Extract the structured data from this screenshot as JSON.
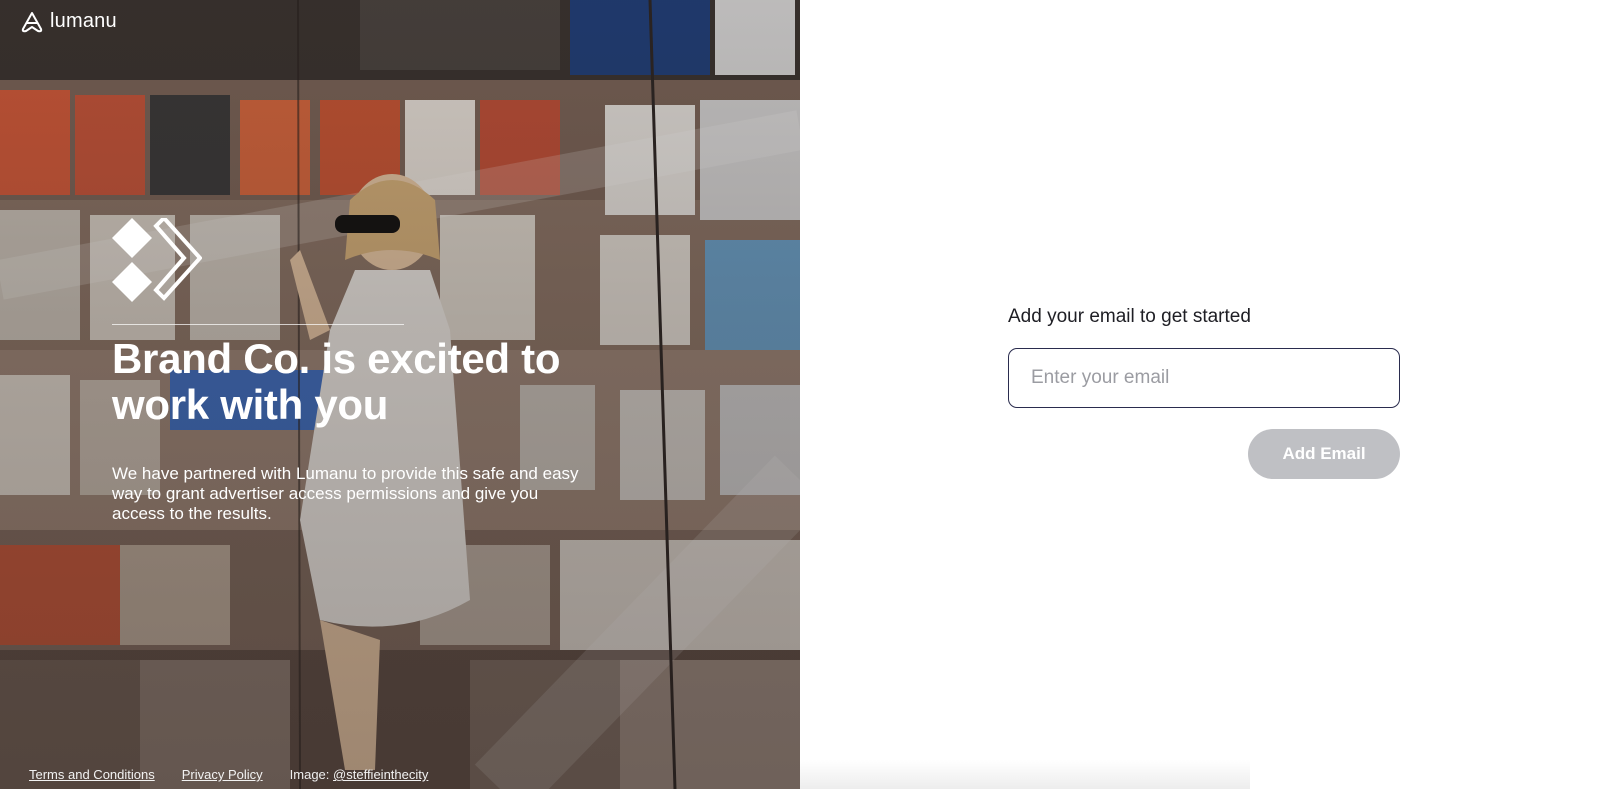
{
  "brand": {
    "name": "lumanu",
    "icon": "lumanu-logo-icon"
  },
  "hero": {
    "partner_logo": "partner-x-logo",
    "title": "Brand Co. is excited to work with you",
    "description": "We have partnered with Lumanu to provide this safe and easy way to grant advertiser access permissions and give you access to the results.",
    "image": "woman-at-magazine-stand-photo"
  },
  "footer": {
    "terms": "Terms and Conditions",
    "privacy": "Privacy Policy",
    "credit_prefix": "Image:",
    "credit_handle": "@steffieinthecity"
  },
  "form": {
    "label": "Add your email to get started",
    "placeholder": "Enter your email",
    "value": "",
    "button_label": "Add Email",
    "button_color": "#bfc0c4",
    "input_border_color": "#2a2c4e"
  }
}
